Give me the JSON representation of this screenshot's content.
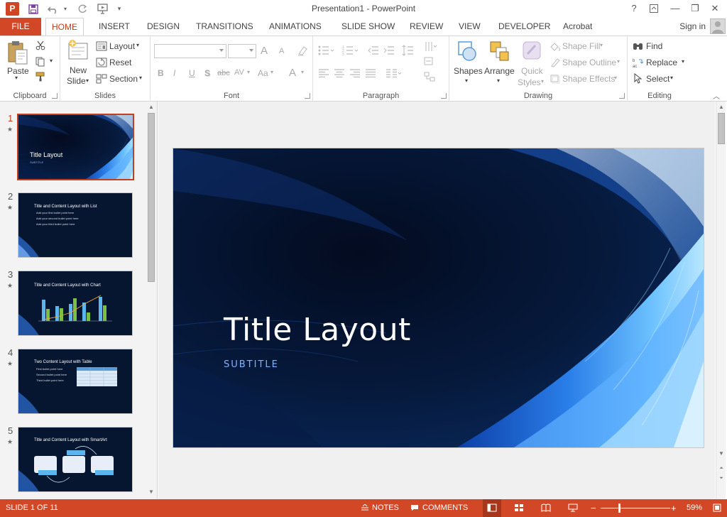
{
  "window": {
    "app_logo": "P",
    "title": "Presentation1 - PowerPoint",
    "help": "?",
    "minimize": "—",
    "restore": "❐",
    "close": "✕"
  },
  "tabs": {
    "file": "FILE",
    "items": [
      "HOME",
      "INSERT",
      "DESIGN",
      "TRANSITIONS",
      "ANIMATIONS",
      "SLIDE SHOW",
      "REVIEW",
      "VIEW",
      "DEVELOPER",
      "Acrobat"
    ],
    "active": "HOME",
    "signin": "Sign in"
  },
  "ribbon": {
    "clipboard": {
      "label": "Clipboard",
      "paste": "Paste"
    },
    "slides": {
      "label": "Slides",
      "new_slide_1": "New",
      "new_slide_2": "Slide",
      "layout": "Layout",
      "reset": "Reset",
      "section": "Section"
    },
    "font": {
      "label": "Font",
      "bold": "B",
      "italic": "I",
      "underline": "U",
      "shadow": "S",
      "strike": "abc",
      "spacing": "AV",
      "case": "Aa",
      "color": "A",
      "grow": "A",
      "shrink": "A"
    },
    "paragraph": {
      "label": "Paragraph"
    },
    "drawing": {
      "label": "Drawing",
      "shapes": "Shapes",
      "arrange": "Arrange",
      "quick_styles_1": "Quick",
      "quick_styles_2": "Styles",
      "shape_fill": "Shape Fill",
      "shape_outline": "Shape Outline",
      "shape_effects": "Shape Effects"
    },
    "editing": {
      "label": "Editing",
      "find": "Find",
      "replace": "Replace",
      "select": "Select"
    }
  },
  "thumbnails": [
    {
      "num": "1",
      "title": "Title Layout",
      "lines": [
        "SUBTITLE"
      ]
    },
    {
      "num": "2",
      "title": "Title and Content Layout with List",
      "lines": [
        "Add your first bullet point here",
        "Add your second bullet point here",
        "Add your third bullet point here"
      ]
    },
    {
      "num": "3",
      "title": "Title and Content Layout with Chart",
      "lines": []
    },
    {
      "num": "4",
      "title": "Two Content Layout with Table",
      "lines": [
        "First bullet point here",
        "Second bullet point here",
        "Third bullet point here"
      ]
    },
    {
      "num": "5",
      "title": "Title and Content Layout with SmartArt",
      "lines": []
    }
  ],
  "slide": {
    "title": "Title Layout",
    "subtitle": "SUBTITLE"
  },
  "status": {
    "slide_info": "SLIDE 1 OF 11",
    "notes": "NOTES",
    "comments": "COMMENTS",
    "zoom": "59%",
    "zoom_level": 0.59
  },
  "colors": {
    "accent": "#d24726",
    "active_tab_text": "#c43e1c"
  }
}
